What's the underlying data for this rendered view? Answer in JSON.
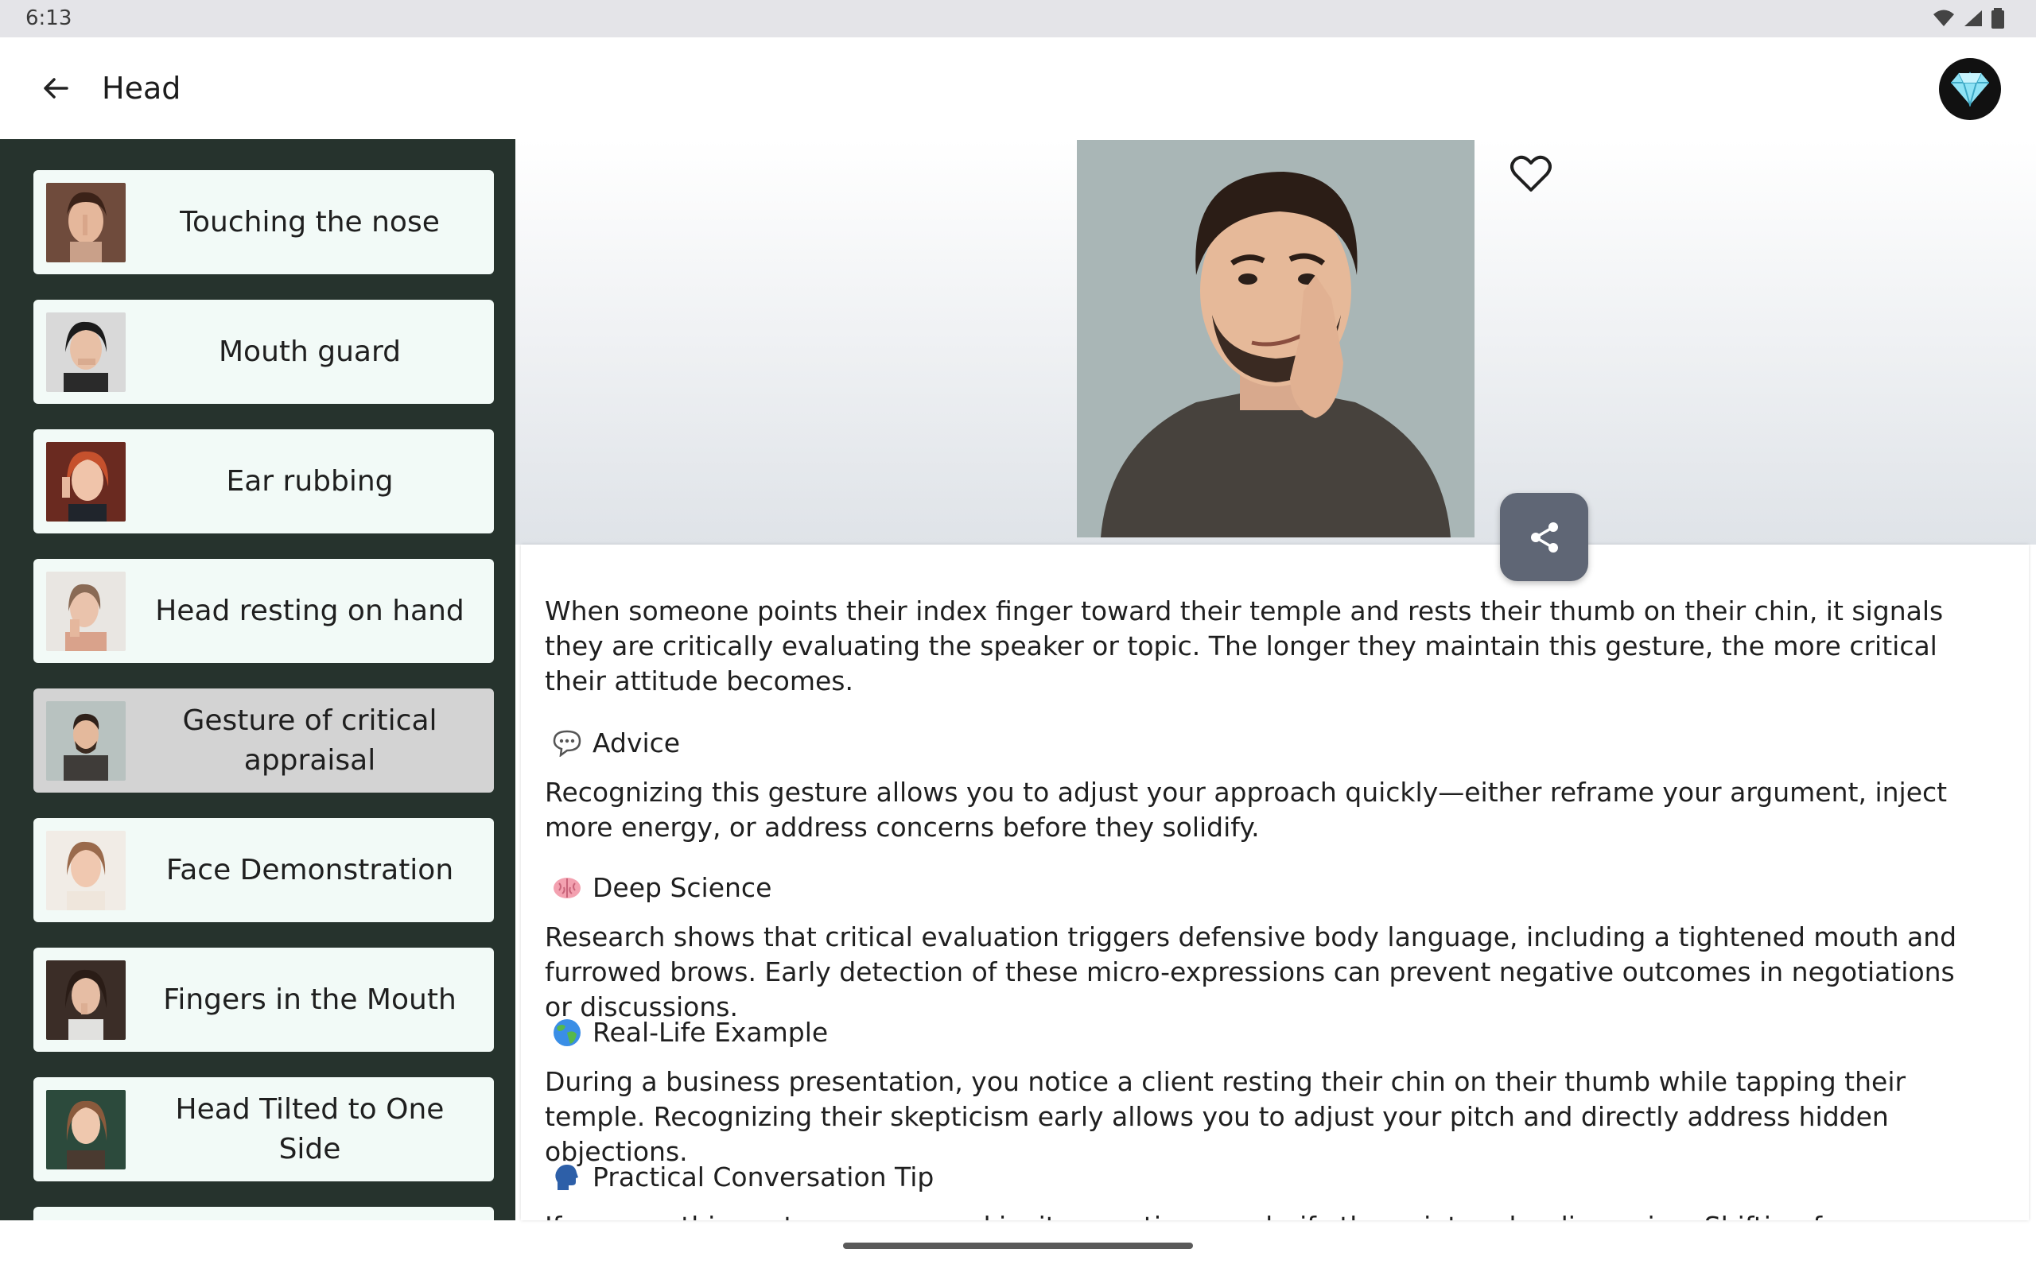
{
  "status": {
    "time": "6:13"
  },
  "appbar": {
    "title": "Head"
  },
  "sidebar": {
    "items": [
      {
        "label": "Touching the nose"
      },
      {
        "label": "Mouth guard"
      },
      {
        "label": "Ear rubbing"
      },
      {
        "label": "Head resting on hand"
      },
      {
        "label": "Gesture of critical appraisal"
      },
      {
        "label": "Face Demonstration"
      },
      {
        "label": "Fingers in the Mouth"
      },
      {
        "label": "Head Tilted to One Side"
      }
    ]
  },
  "detail": {
    "intro": "When someone points their index finger toward their temple and rests their thumb on their chin, it signals they are critically evaluating the speaker or topic. The longer they maintain this gesture, the more critical their attitude becomes.",
    "sections": [
      {
        "heading": "Advice",
        "icon": "speech-bubble-icon",
        "body": "Recognizing this gesture allows you to adjust your approach quickly—either reframe your argument, inject more energy, or address concerns before they solidify."
      },
      {
        "heading": "Deep Science",
        "icon": "brain-icon",
        "body": "Research shows that critical evaluation triggers defensive body language, including a tightened mouth and furrowed brows. Early detection of these micro-expressions can prevent negative outcomes in negotiations or discussions."
      },
      {
        "heading": "Real-Life Example",
        "icon": "globe-icon",
        "body": "During a business presentation, you notice a client resting their chin on their thumb while tapping their temple. Recognizing their skepticism early allows you to adjust your pitch and directly address hidden objections."
      },
      {
        "heading": "Practical Conversation Tip",
        "icon": "speaking-head-icon",
        "body": "If you see this gesture, pause and invite questions or clarify the point under discussion. Shifting focus"
      }
    ]
  },
  "colors": {
    "sidebar_bg": "#26332d",
    "card_bg": "#f2faf7",
    "selected_card_bg": "#d3d3d3",
    "share_bg": "#5f6675"
  }
}
